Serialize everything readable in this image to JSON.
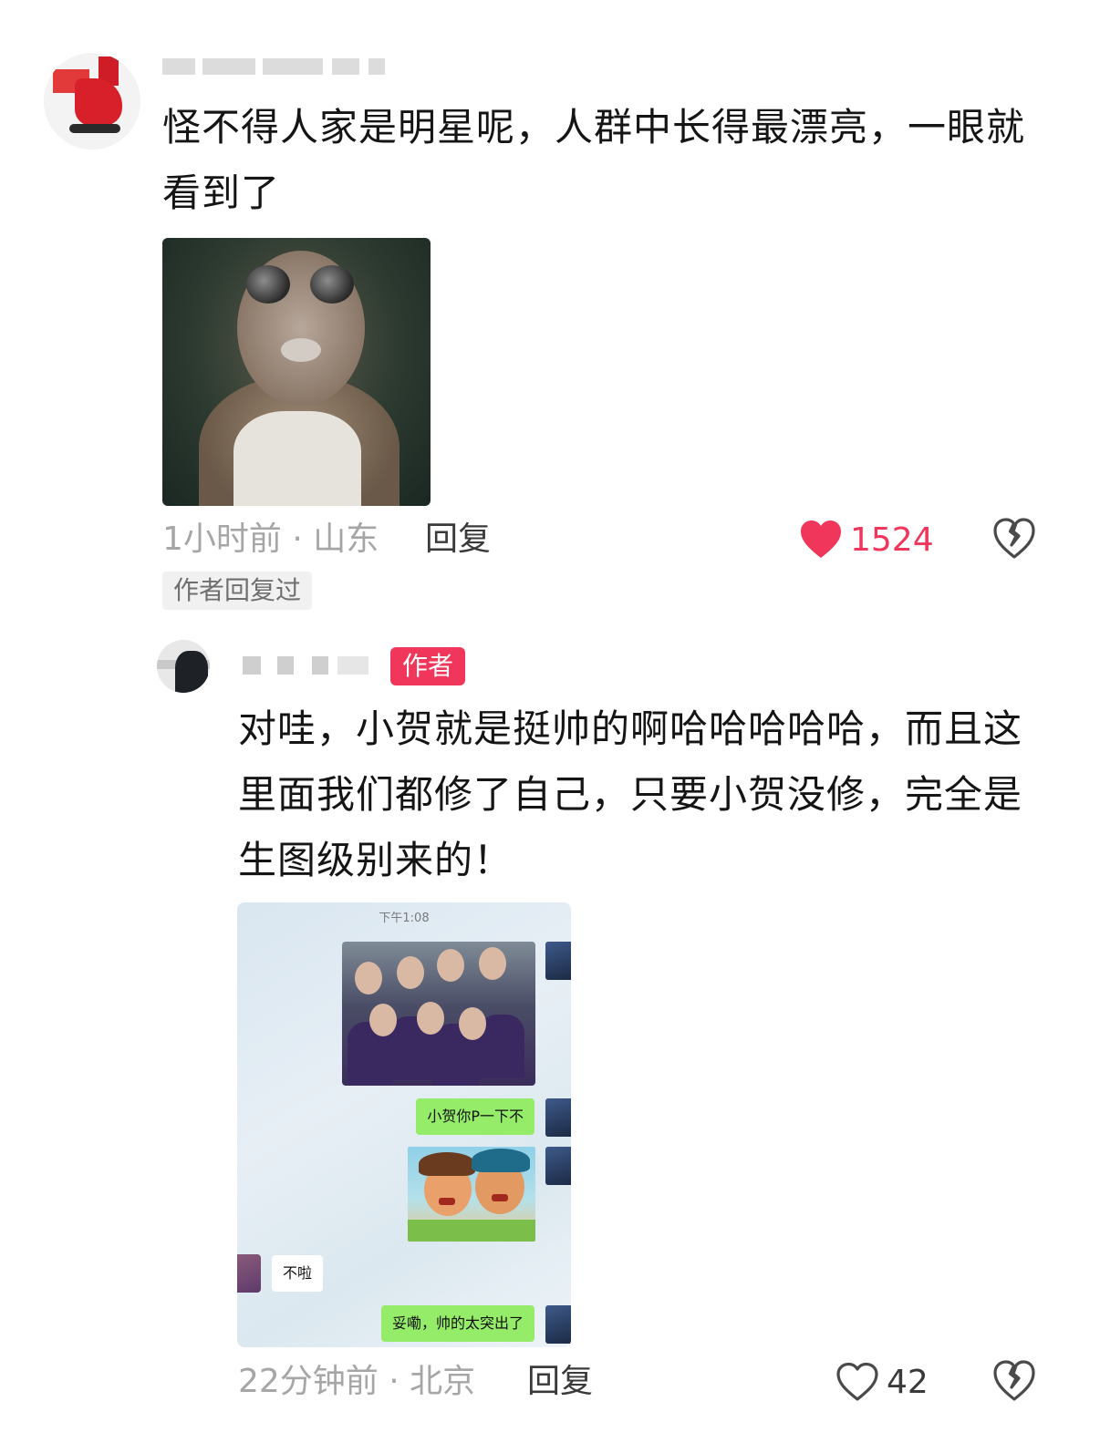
{
  "comment": {
    "text": "怪不得人家是明星呢，人群中长得最漂亮，一眼就看到了",
    "time_location": "1小时前 · 山东",
    "reply_label": "回复",
    "like_count": "1524",
    "liked": true,
    "author_replied_tag": "作者回复过",
    "image_icon": "meme-image"
  },
  "reply": {
    "author_badge": "作者",
    "text": "对哇，小贺就是挺帅的啊哈哈哈哈哈，而且这里面我们都修了自己，只要小贺没修，完全是生图级别来的！",
    "time_location": "22分钟前 · 北京",
    "reply_label": "回复",
    "like_count": "42",
    "liked": false,
    "chat": {
      "time": "下午1:08",
      "msg1": "小贺你P一下不",
      "msg2": "不啦",
      "msg3": "妥嘞，帅的太突出了"
    }
  },
  "colors": {
    "accent": "#f0365a",
    "meta": "#a6a6a6",
    "text": "#151515",
    "wechat_green": "#95ec69"
  }
}
